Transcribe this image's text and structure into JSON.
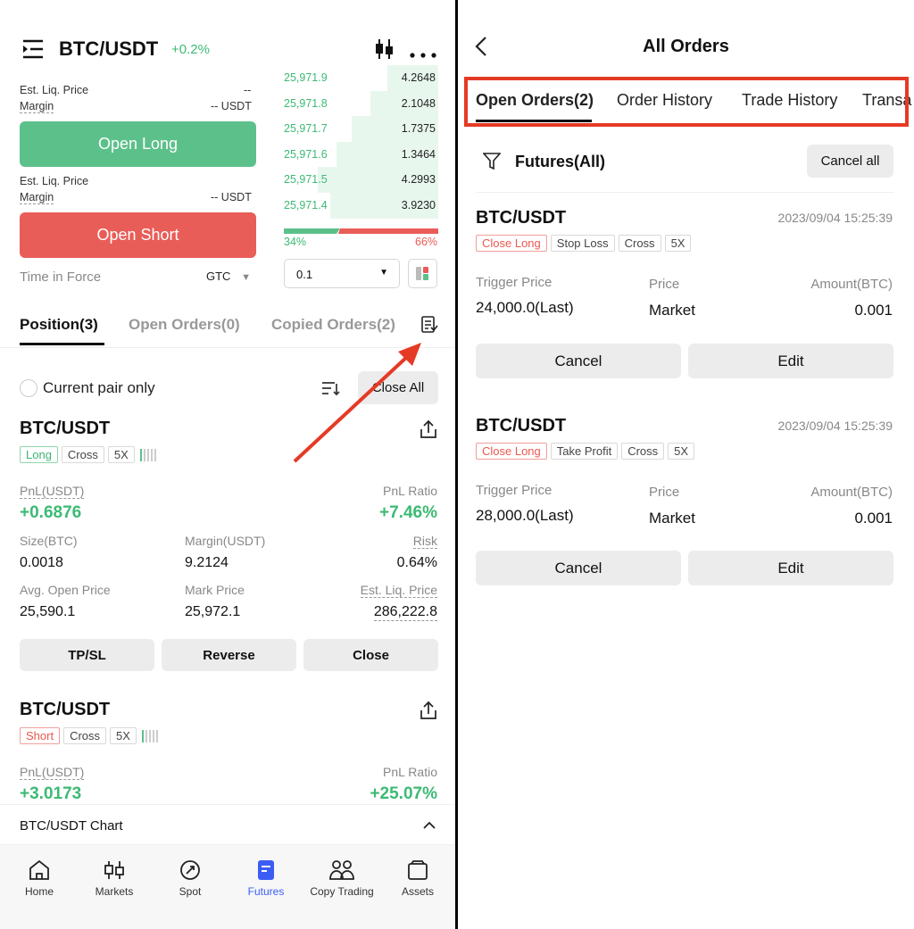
{
  "left": {
    "header": {
      "pair": "BTC/USDT",
      "change": "+0.2%"
    },
    "long_panel": {
      "liq_label": "Est. Liq. Price",
      "liq_value": "--",
      "margin_label": "Margin",
      "margin_value": "-- USDT",
      "button": "Open Long"
    },
    "short_panel": {
      "liq_label": "Est. Liq. Price",
      "margin_label": "Margin",
      "margin_value": "-- USDT",
      "button": "Open Short"
    },
    "time_in_force": {
      "label": "Time in Force",
      "value": "GTC"
    },
    "orderbook": {
      "rows": [
        {
          "price": "25,971.9",
          "qty": "4.2648",
          "depth": 0.33
        },
        {
          "price": "25,971.8",
          "qty": "2.1048",
          "depth": 0.44
        },
        {
          "price": "25,971.7",
          "qty": "1.7375",
          "depth": 0.56
        },
        {
          "price": "25,971.6",
          "qty": "1.3464",
          "depth": 0.66
        },
        {
          "price": "25,971.5",
          "qty": "4.2993",
          "depth": 0.78
        },
        {
          "price": "25,971.4",
          "qty": "3.9230",
          "depth": 0.7
        }
      ],
      "buy_pct": "34%",
      "sell_pct": "66%",
      "buy_ratio": 0.34,
      "precision": "0.1"
    },
    "tabs": {
      "position": "Position(3)",
      "open_orders": "Open Orders(0)",
      "copied_orders": "Copied Orders(2)"
    },
    "filter": {
      "current_pair": "Current pair only",
      "close_all": "Close All"
    },
    "positions": [
      {
        "pair": "BTC/USDT",
        "side": "Long",
        "mode": "Cross",
        "leverage": "5X",
        "pnl_label": "PnL(USDT)",
        "pnl": "+0.6876",
        "ratio_label": "PnL Ratio",
        "ratio": "+7.46%",
        "size_label": "Size(BTC)",
        "size": "0.0018",
        "margin_label": "Margin(USDT)",
        "margin": "9.2124",
        "risk_label": "Risk",
        "risk": "0.64%",
        "avg_label": "Avg. Open Price",
        "avg": "25,590.1",
        "mark_label": "Mark Price",
        "mark": "25,972.1",
        "liq_label": "Est. Liq. Price",
        "liq": "286,222.8",
        "actions": [
          "TP/SL",
          "Reverse",
          "Close"
        ]
      },
      {
        "pair": "BTC/USDT",
        "side": "Short",
        "mode": "Cross",
        "leverage": "5X",
        "pnl_label": "PnL(USDT)",
        "pnl": "+3.0173",
        "ratio_label": "PnL Ratio",
        "ratio": "+25.07%"
      }
    ],
    "chart_bar": "BTC/USDT Chart",
    "nav": [
      "Home",
      "Markets",
      "Spot",
      "Futures",
      "Copy Trading",
      "Assets"
    ],
    "nav_active": "Futures"
  },
  "right": {
    "title": "All Orders",
    "tabs": [
      "Open Orders(2)",
      "Order History",
      "Trade History",
      "Transa"
    ],
    "filter_label": "Futures(All)",
    "cancel_all": "Cancel all",
    "orders": [
      {
        "pair": "BTC/USDT",
        "time": "2023/09/04 15:25:39",
        "tags": [
          "Close Long",
          "Stop Loss",
          "Cross",
          "5X"
        ],
        "trigger_label": "Trigger Price",
        "trigger": "24,000.0(Last)",
        "price_label": "Price",
        "price": "Market",
        "amount_label": "Amount(BTC)",
        "amount": "0.001",
        "cancel": "Cancel",
        "edit": "Edit"
      },
      {
        "pair": "BTC/USDT",
        "time": "2023/09/04 15:25:39",
        "tags": [
          "Close Long",
          "Take Profit",
          "Cross",
          "5X"
        ],
        "trigger_label": "Trigger Price",
        "trigger": "28,000.0(Last)",
        "price_label": "Price",
        "price": "Market",
        "amount_label": "Amount(BTC)",
        "amount": "0.001",
        "cancel": "Cancel",
        "edit": "Edit"
      }
    ]
  },
  "colors": {
    "green": "#5cc08a",
    "red": "#e95d58",
    "accent_blue": "#3b5cf5",
    "annotation_red": "#e53a25"
  }
}
